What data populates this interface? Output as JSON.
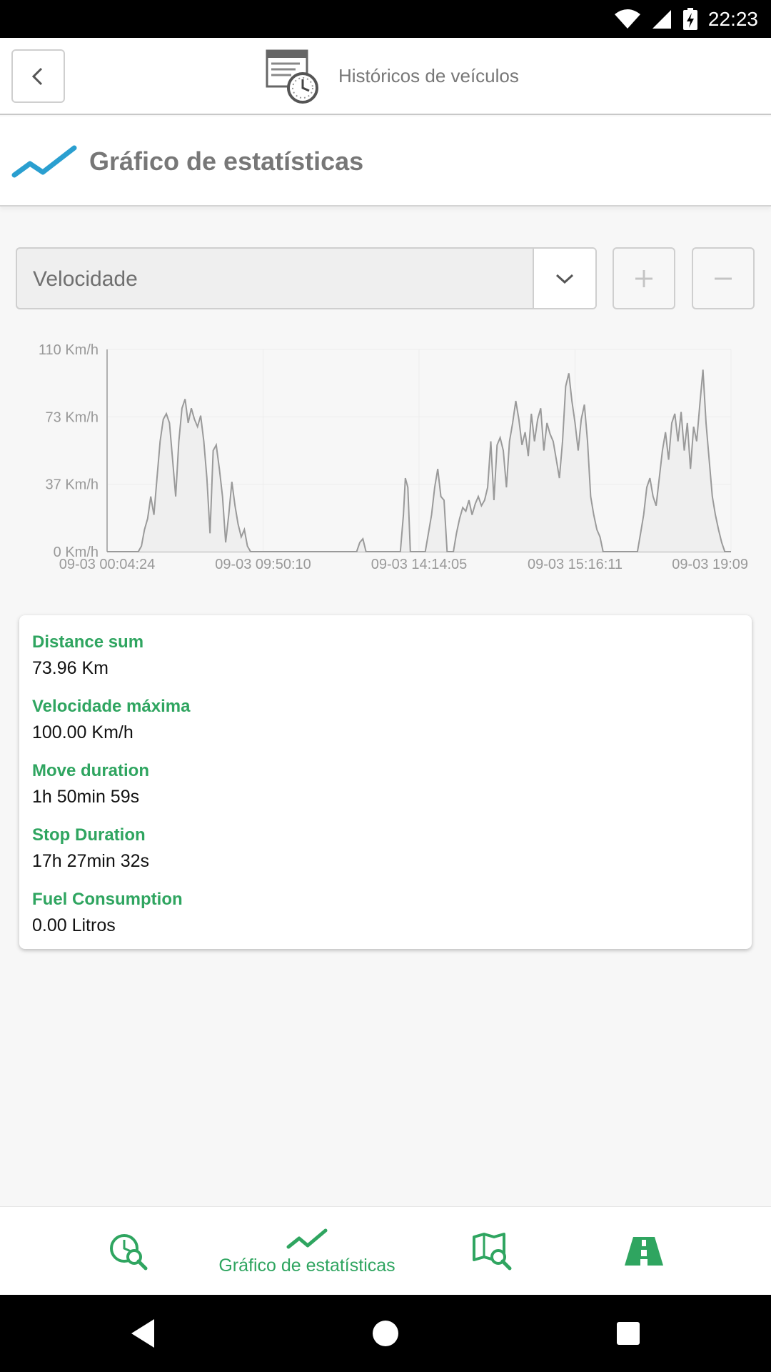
{
  "status_bar": {
    "time": "22:23"
  },
  "header": {
    "title": "Históricos de veículos"
  },
  "section": {
    "title": "Gráfico de estatísticas"
  },
  "controls": {
    "selected_metric": "Velocidade",
    "zoom_in": "+",
    "zoom_out": "−"
  },
  "chart_data": {
    "type": "area",
    "title": "",
    "xlabel": "",
    "ylabel": "",
    "y_ticks": [
      "0 Km/h",
      "37 Km/h",
      "73 Km/h",
      "110 Km/h"
    ],
    "x_ticks": [
      "09-03 00:04:24",
      "09-03 09:50:10",
      "09-03 14:14:05",
      "09-03 15:16:11",
      "09-03 19:09"
    ],
    "ylim": [
      0,
      110
    ],
    "grid": true,
    "color": "#9a9a9a",
    "series": [
      {
        "name": "",
        "points": [
          [
            0,
            0
          ],
          [
            5,
            0
          ],
          [
            5.5,
            3
          ],
          [
            6,
            12
          ],
          [
            6.5,
            18
          ],
          [
            7,
            30
          ],
          [
            7.5,
            20
          ],
          [
            8,
            40
          ],
          [
            8.5,
            60
          ],
          [
            9,
            72
          ],
          [
            9.5,
            75
          ],
          [
            10,
            70
          ],
          [
            10.5,
            50
          ],
          [
            11,
            30
          ],
          [
            11.5,
            60
          ],
          [
            12,
            78
          ],
          [
            12.5,
            83
          ],
          [
            13,
            70
          ],
          [
            13.5,
            78
          ],
          [
            14,
            72
          ],
          [
            14.5,
            68
          ],
          [
            15,
            74
          ],
          [
            15.5,
            60
          ],
          [
            16,
            40
          ],
          [
            16.5,
            10
          ],
          [
            17,
            55
          ],
          [
            17.5,
            58
          ],
          [
            18,
            45
          ],
          [
            18.5,
            30
          ],
          [
            19,
            5
          ],
          [
            19.5,
            20
          ],
          [
            20,
            38
          ],
          [
            20.5,
            25
          ],
          [
            21,
            15
          ],
          [
            21.5,
            8
          ],
          [
            22,
            12
          ],
          [
            22.5,
            3
          ],
          [
            23,
            0
          ],
          [
            40,
            0
          ],
          [
            40.5,
            5
          ],
          [
            41,
            7
          ],
          [
            41.5,
            0
          ],
          [
            47,
            0
          ],
          [
            47.5,
            20
          ],
          [
            47.8,
            40
          ],
          [
            48.2,
            35
          ],
          [
            48.6,
            0
          ],
          [
            51,
            0
          ],
          [
            51.5,
            10
          ],
          [
            52,
            20
          ],
          [
            52.5,
            35
          ],
          [
            53,
            45
          ],
          [
            53.5,
            30
          ],
          [
            54,
            28
          ],
          [
            54.5,
            0
          ],
          [
            55.5,
            0
          ],
          [
            56,
            10
          ],
          [
            56.5,
            18
          ],
          [
            57,
            24
          ],
          [
            57.5,
            22
          ],
          [
            58,
            28
          ],
          [
            58.5,
            20
          ],
          [
            59,
            26
          ],
          [
            59.5,
            30
          ],
          [
            60,
            25
          ],
          [
            60.5,
            28
          ],
          [
            61,
            35
          ],
          [
            61.5,
            60
          ],
          [
            62,
            28
          ],
          [
            62.5,
            58
          ],
          [
            63,
            62
          ],
          [
            63.5,
            55
          ],
          [
            64,
            35
          ],
          [
            64.5,
            60
          ],
          [
            65,
            70
          ],
          [
            65.5,
            82
          ],
          [
            66,
            72
          ],
          [
            66.5,
            58
          ],
          [
            67,
            65
          ],
          [
            67.5,
            52
          ],
          [
            68,
            75
          ],
          [
            68.5,
            60
          ],
          [
            69,
            72
          ],
          [
            69.5,
            78
          ],
          [
            70,
            55
          ],
          [
            70.5,
            70
          ],
          [
            71,
            64
          ],
          [
            71.5,
            60
          ],
          [
            72,
            50
          ],
          [
            72.5,
            40
          ],
          [
            73,
            60
          ],
          [
            73.5,
            90
          ],
          [
            74,
            97
          ],
          [
            74.5,
            82
          ],
          [
            75,
            70
          ],
          [
            75.5,
            55
          ],
          [
            76,
            72
          ],
          [
            76.5,
            80
          ],
          [
            77,
            60
          ],
          [
            77.5,
            30
          ],
          [
            78,
            20
          ],
          [
            78.5,
            12
          ],
          [
            79,
            8
          ],
          [
            79.5,
            0
          ],
          [
            85,
            0
          ],
          [
            85.5,
            10
          ],
          [
            86,
            20
          ],
          [
            86.5,
            35
          ],
          [
            87,
            40
          ],
          [
            87.5,
            30
          ],
          [
            88,
            25
          ],
          [
            88.5,
            40
          ],
          [
            89,
            55
          ],
          [
            89.5,
            65
          ],
          [
            90,
            50
          ],
          [
            90.5,
            70
          ],
          [
            91,
            75
          ],
          [
            91.5,
            60
          ],
          [
            92,
            76
          ],
          [
            92.5,
            55
          ],
          [
            93,
            70
          ],
          [
            93.5,
            45
          ],
          [
            94,
            68
          ],
          [
            94.5,
            60
          ],
          [
            95,
            80
          ],
          [
            95.5,
            99
          ],
          [
            96,
            70
          ],
          [
            96.5,
            50
          ],
          [
            97,
            30
          ],
          [
            97.5,
            20
          ],
          [
            98,
            12
          ],
          [
            98.5,
            5
          ],
          [
            99,
            0
          ],
          [
            100,
            0
          ]
        ]
      }
    ]
  },
  "stats": [
    {
      "label": "Distance sum",
      "value": "73.96 Km"
    },
    {
      "label": "Velocidade máxima",
      "value": "100.00 Km/h"
    },
    {
      "label": "Move duration",
      "value": "1h 50min 59s"
    },
    {
      "label": "Stop Duration",
      "value": "17h 27min 32s"
    },
    {
      "label": "Fuel Consumption",
      "value": "0.00 Litros"
    }
  ],
  "bottom_nav": {
    "active_label": "Gráfico de estatísticas"
  },
  "icons": {
    "back": "chevron-left-icon",
    "header": "history-report-icon",
    "section": "trend-line-icon",
    "caret": "chevron-down-icon",
    "nav": [
      "speed-search-icon",
      "trend-line-icon",
      "map-search-icon",
      "road-icon"
    ]
  },
  "colors": {
    "accent": "#2fa560",
    "section_icon": "#2a9fd0",
    "chart_line": "#9a9a9a"
  }
}
